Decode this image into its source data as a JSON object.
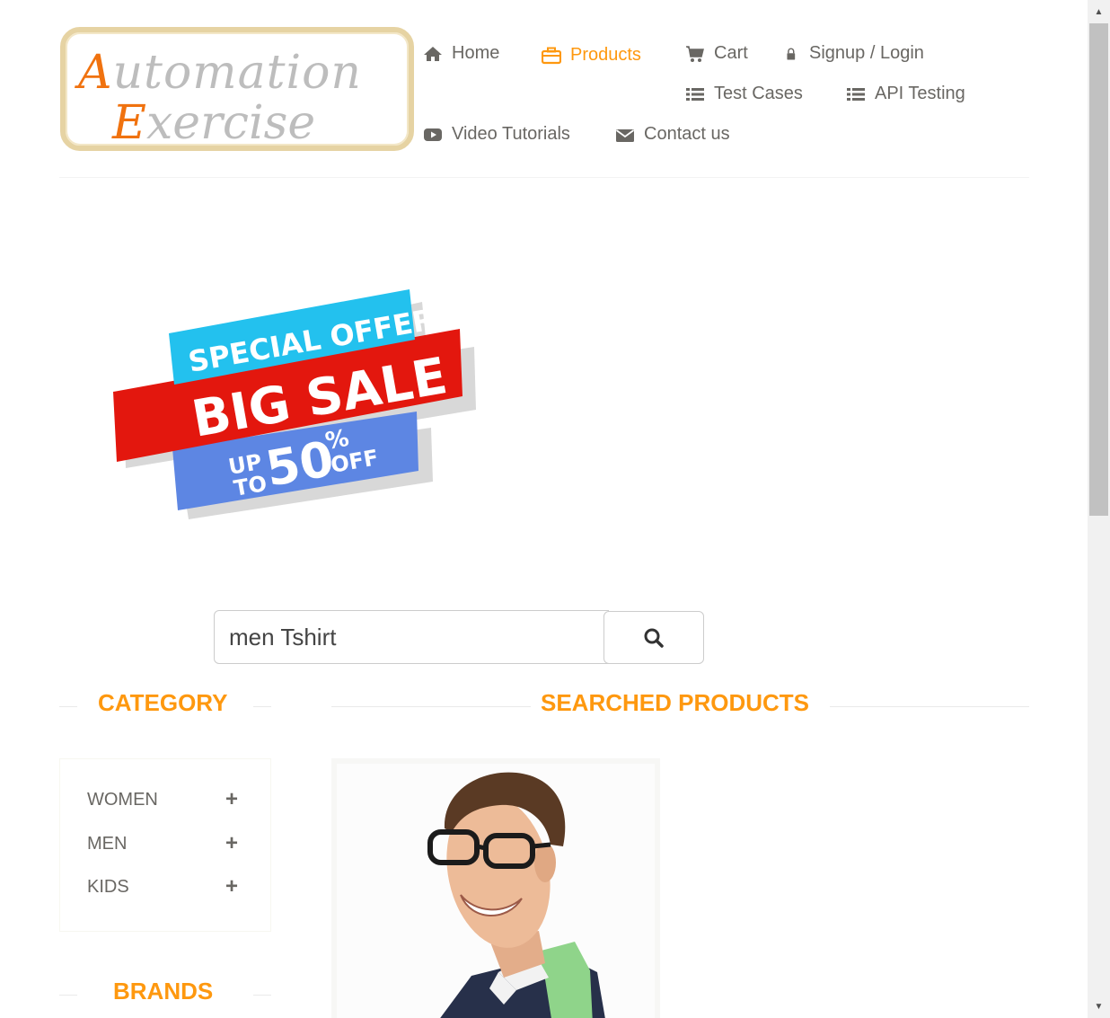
{
  "logo": {
    "line1": "Automation",
    "line2": "Exercise"
  },
  "nav": {
    "home": "Home",
    "products": "Products",
    "cart": "Cart",
    "signup_login": "Signup / Login",
    "test_cases": "Test Cases",
    "api_testing": "API Testing",
    "video_tutorials": "Video Tutorials",
    "contact_us": "Contact us"
  },
  "banner": {
    "special_offer": "SPECIAL OFFER",
    "big_sale": "BIG SALE",
    "up": "UP",
    "to": "TO",
    "amount": "50",
    "percent": "%",
    "off": "OFF"
  },
  "search": {
    "value": "men Tshirt"
  },
  "sections": {
    "category": "Category",
    "searched_products": "Searched Products",
    "brands": "Brands"
  },
  "categories": [
    {
      "label": "Women",
      "toggle": "+"
    },
    {
      "label": "Men",
      "toggle": "+"
    },
    {
      "label": "Kids",
      "toggle": "+"
    }
  ],
  "colors": {
    "accent": "#fe980f",
    "text": "#696763"
  }
}
